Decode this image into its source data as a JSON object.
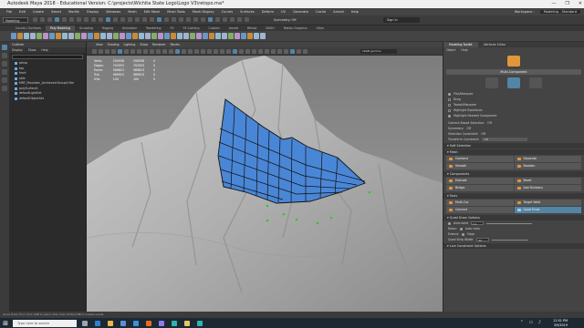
{
  "window": {
    "title": "Autodesk Maya 2018 - Educational Version: C:\\projects\\Wichita State Logo\\Logo V3\\retopo.ma*",
    "controls": [
      "—",
      "❐",
      "✕"
    ]
  },
  "menubar": [
    "File",
    "Edit",
    "Create",
    "Select",
    "Modify",
    "Display",
    "Windows",
    "Mesh",
    "Edit Mesh",
    "Mesh Tools",
    "Mesh Display",
    "Curves",
    "Surfaces",
    "Deform",
    "UV",
    "Generate",
    "Cache",
    "Arnold",
    "Help"
  ],
  "workspace": {
    "label": "Workspace :",
    "value": "Modeling - Standard"
  },
  "statusline": {
    "menuset": "Modeling",
    "symmetry": "Symmetry: Off",
    "signin": "Sign In"
  },
  "shelf_tabs": [
    "Curves / Surfaces",
    "Poly Modeling",
    "Sculpting",
    "Rigging",
    "Animation",
    "Rendering",
    "FX",
    "FX Caching",
    "Custom",
    "Arnold",
    "Bifrost",
    "MASH",
    "Motion Graphics",
    "XGen"
  ],
  "shelf_active": 1,
  "outliner": {
    "title": "Outliner",
    "menu": [
      "Display",
      "Show",
      "Help"
    ],
    "items": [
      "persp",
      "top",
      "front",
      "side",
      "MRF_Mountain_Archieved:Group0:Hm",
      "polySurface1",
      "defaultLightSet",
      "defaultObjectSet"
    ]
  },
  "viewport": {
    "menu": [
      "View",
      "Shading",
      "Lighting",
      "Show",
      "Renderer",
      "Panels"
    ],
    "gamma": "sRGB gamma",
    "hud": {
      "rows": [
        [
          "Verts:",
          "290938",
          "290938",
          "0"
        ],
        [
          "Edges:",
          "702053",
          "702053",
          "0"
        ],
        [
          "Faces:",
          "589813",
          "589813",
          "0"
        ],
        [
          "Tris:",
          "969915",
          "969915",
          "0"
        ],
        [
          "UVs:",
          "100",
          "100",
          "0"
        ]
      ]
    }
  },
  "toolkit": {
    "tabs": [
      "Modeling Toolkit",
      "Attribute Editor"
    ],
    "menu": [
      "Object",
      "Help"
    ],
    "mode": "Multi-Component",
    "options": [
      {
        "label": "Pick/Marquee",
        "on": true
      },
      {
        "label": "Drag",
        "on": false
      },
      {
        "label": "Tweak/Marquee",
        "on": false
      },
      {
        "label": "Highlight Backfaces",
        "on": false
      },
      {
        "label": "Highlight Nearest Component",
        "on": true
      }
    ],
    "camera_based": "Camera Based Selection:",
    "camera_based_value": "Off",
    "symmetry": "Symmetry:",
    "symmetry_value": "Off",
    "soft_constraint": "Selection Constraint:",
    "soft_constraint_value": "Off",
    "transform_constraint": "Transform Constraint:",
    "transform_constraint_value": "Off",
    "soft_selection": "Soft Selection",
    "sections": {
      "mesh": "Mesh",
      "mesh_buttons": [
        "Combine",
        "Separate",
        "Smooth",
        "Boolean"
      ],
      "components": "Components",
      "component_buttons": [
        "Extrude",
        "Bevel",
        "Bridge",
        "Add Divisions"
      ],
      "tools": "Tools",
      "tool_buttons": [
        "Multi-Cut",
        "Target Weld",
        "Connect",
        "Quad Draw"
      ],
      "quad_draw": "Quad Draw Options",
      "auto_weld": "Auto weld",
      "auto_weld_value": "0.1",
      "relax_label": "Relax:",
      "relax_value": "Auto relax",
      "extend_label": "Extend:",
      "extend_value": "Edge",
      "strip_label": "Quad Strip Width:",
      "strip_value": "20",
      "live_constraint": "Live Constraint Options"
    }
  },
  "cmdline": "Quad Draw Tool: Click LMB to place dots, then Shift+LMB to create quads.",
  "taskbar": {
    "search": "Type here to search",
    "time": "12:51 PM",
    "date": "3/9/2019",
    "icons": [
      {
        "name": "task-view-icon",
        "color": "#9aa6b2"
      },
      {
        "name": "edge-icon",
        "color": "#2f7fd1"
      },
      {
        "name": "explorer-icon",
        "color": "#e8b94a"
      },
      {
        "name": "store-icon",
        "color": "#5a8fd8"
      },
      {
        "name": "mail-icon",
        "color": "#3c8fd8"
      },
      {
        "name": "houdini-icon",
        "color": "#f06a1d"
      },
      {
        "name": "premiere-icon",
        "color": "#8a7cf5"
      },
      {
        "name": "maya-icon",
        "color": "#2fb3b1"
      },
      {
        "name": "files-icon",
        "color": "#e4c766"
      },
      {
        "name": "maya2-icon",
        "color": "#2fb3b1"
      }
    ]
  }
}
